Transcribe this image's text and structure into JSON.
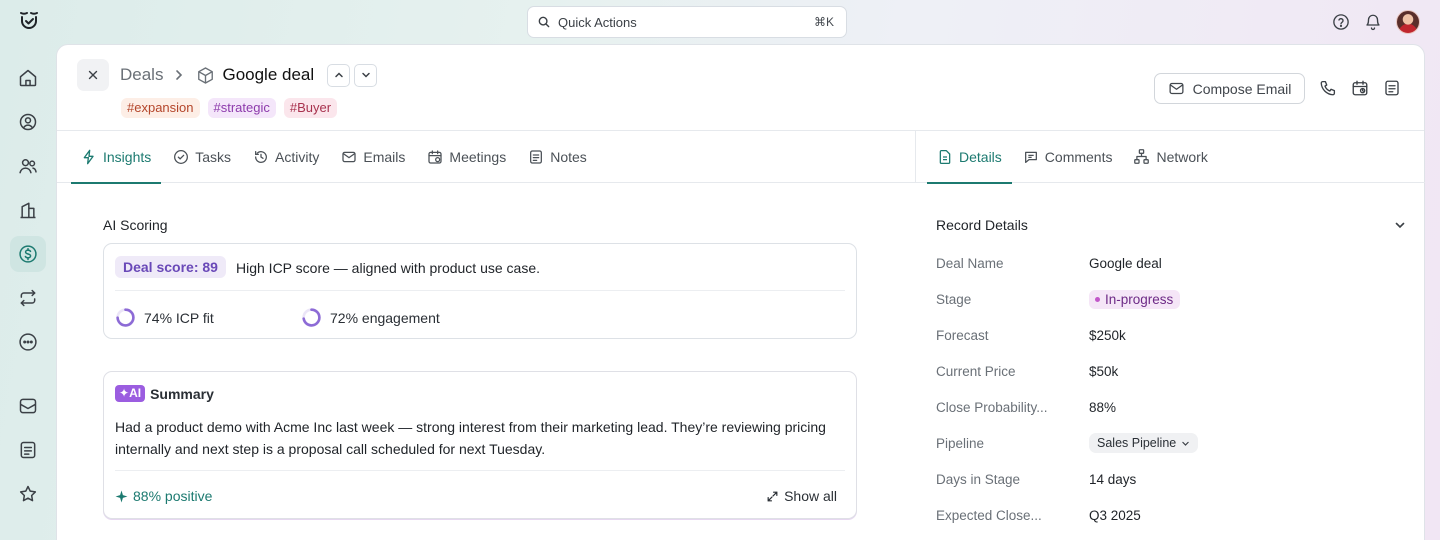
{
  "topbar": {
    "quick_actions": "Quick Actions",
    "shortcut": "⌘K",
    "icons": [
      "help-icon",
      "bell-icon",
      "avatar"
    ]
  },
  "rail": {
    "items": [
      "home-icon",
      "contacts-icon",
      "people-icon",
      "companies-icon",
      "deals-icon",
      "workflows-icon",
      "more-icon",
      "inbox-icon",
      "notes-icon",
      "favorites-icon"
    ],
    "active": "deals-icon"
  },
  "header": {
    "breadcrumb_root": "Deals",
    "title": "Google deal",
    "tags": [
      "#expansion",
      "#strategic",
      "#Buyer"
    ],
    "compose_label": "Compose Email"
  },
  "left_tabs": [
    "Insights",
    "Tasks",
    "Activity",
    "Emails",
    "Meetings",
    "Notes"
  ],
  "right_tabs": [
    "Details",
    "Comments",
    "Network"
  ],
  "ai_scoring": {
    "section_label": "AI Scoring",
    "deal_score": "Deal score: 89",
    "description": "High ICP score — aligned with product use case.",
    "icp_fit": "74% ICP fit",
    "icp_fit_value": 0.74,
    "engagement": "72% engagement",
    "engagement_value": 0.72
  },
  "summary": {
    "badge": "AI",
    "title": "Summary",
    "text": "Had a product demo with Acme Inc last week — strong interest from their marketing lead. They’re reviewing pricing internally and next step is a proposal call scheduled for next Tuesday.",
    "sentiment": "88% positive",
    "show_all": "Show all"
  },
  "record_details": {
    "title": "Record Details",
    "rows": [
      {
        "label": "Deal Name",
        "value": "Google deal"
      },
      {
        "label": "Stage",
        "value": "In-progress"
      },
      {
        "label": "Forecast",
        "value": "$250k"
      },
      {
        "label": "Current Price",
        "value": "$50k"
      },
      {
        "label": "Close Probability...",
        "value": "88%"
      },
      {
        "label": "Pipeline",
        "value": "Sales Pipeline"
      },
      {
        "label": "Days in Stage",
        "value": "14 days"
      },
      {
        "label": "Expected Close...",
        "value": "Q3 2025"
      }
    ]
  },
  "colors": {
    "accent": "#1c7a70",
    "score_purple": "#6a49b8",
    "stage_pill": "#f5e6f7"
  }
}
